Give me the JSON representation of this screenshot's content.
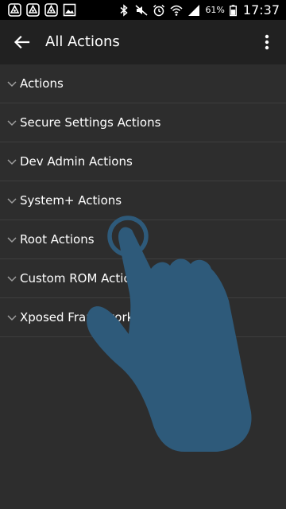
{
  "status_bar": {
    "notification_icons": [
      "app-notification-icon",
      "app-notification-icon",
      "app-notification-icon",
      "image-notification-icon"
    ],
    "system_icons": [
      "bluetooth-icon",
      "mute-icon",
      "alarm-icon",
      "wifi-icon",
      "signal-icon"
    ],
    "battery_percent": "61%",
    "time": "17:37"
  },
  "app_bar": {
    "title": "All Actions",
    "back_icon": "arrow-back-icon",
    "menu_icon": "more-vert-icon"
  },
  "actions_list": {
    "items": [
      {
        "label": "Actions"
      },
      {
        "label": "Secure Settings Actions"
      },
      {
        "label": "Dev Admin Actions"
      },
      {
        "label": "System+ Actions"
      },
      {
        "label": "Root Actions"
      },
      {
        "label": "Custom ROM Actions"
      },
      {
        "label": "Xposed Framework Actions"
      }
    ]
  },
  "overlay": {
    "icon": "tap-gesture-hand-icon"
  },
  "colors": {
    "background": "#2d2d2d",
    "app_bar": "#212121",
    "status_bar": "#000000",
    "divider": "#3e3e3e",
    "hand": "#2e5a7a"
  }
}
